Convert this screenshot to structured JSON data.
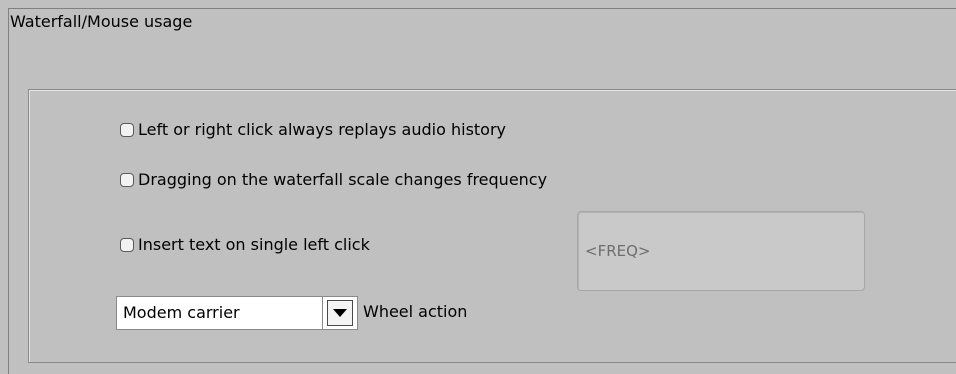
{
  "panel": {
    "title": "Waterfall/Mouse usage"
  },
  "options": [
    {
      "label": "Left or right click always replays audio history",
      "checked": false
    },
    {
      "label": "Dragging on the waterfall scale changes frequency",
      "checked": false
    },
    {
      "label": "Insert text on single left click",
      "checked": false
    }
  ],
  "insert_text": {
    "value": "<FREQ>"
  },
  "wheel": {
    "selected": "Modem carrier",
    "label": "Wheel action"
  }
}
